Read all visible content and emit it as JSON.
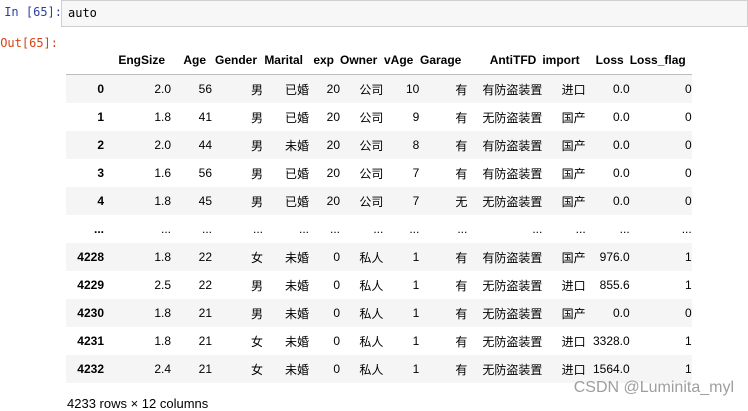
{
  "cell": {
    "in_prompt": "In [65]:",
    "input_code": "auto",
    "out_prompt": "Out[65]:"
  },
  "table": {
    "columns": [
      "",
      "EngSize",
      "Age",
      "Gender",
      "Marital",
      "exp",
      "Owner",
      "vAge",
      "Garage",
      "AntiTFD",
      "import",
      "Loss",
      "Loss_flag"
    ],
    "rows": [
      [
        "0",
        "2.0",
        "56",
        "男",
        "已婚",
        "20",
        "公司",
        "10",
        "有",
        "有防盗装置",
        "进口",
        "0.0",
        "0"
      ],
      [
        "1",
        "1.8",
        "41",
        "男",
        "已婚",
        "20",
        "公司",
        "9",
        "有",
        "无防盗装置",
        "国产",
        "0.0",
        "0"
      ],
      [
        "2",
        "2.0",
        "44",
        "男",
        "未婚",
        "20",
        "公司",
        "8",
        "有",
        "有防盗装置",
        "国产",
        "0.0",
        "0"
      ],
      [
        "3",
        "1.6",
        "56",
        "男",
        "已婚",
        "20",
        "公司",
        "7",
        "有",
        "有防盗装置",
        "国产",
        "0.0",
        "0"
      ],
      [
        "4",
        "1.8",
        "45",
        "男",
        "已婚",
        "20",
        "公司",
        "7",
        "无",
        "无防盗装置",
        "国产",
        "0.0",
        "0"
      ],
      [
        "...",
        "...",
        "...",
        "...",
        "...",
        "...",
        "...",
        "...",
        "...",
        "...",
        "...",
        "...",
        "..."
      ],
      [
        "4228",
        "1.8",
        "22",
        "女",
        "未婚",
        "0",
        "私人",
        "1",
        "有",
        "有防盗装置",
        "国产",
        "976.0",
        "1"
      ],
      [
        "4229",
        "2.5",
        "22",
        "男",
        "未婚",
        "0",
        "私人",
        "1",
        "有",
        "无防盗装置",
        "进口",
        "855.6",
        "1"
      ],
      [
        "4230",
        "1.8",
        "21",
        "男",
        "未婚",
        "0",
        "私人",
        "1",
        "有",
        "无防盗装置",
        "国产",
        "0.0",
        "0"
      ],
      [
        "4231",
        "1.8",
        "21",
        "女",
        "未婚",
        "0",
        "私人",
        "1",
        "有",
        "无防盗装置",
        "进口",
        "3328.0",
        "1"
      ],
      [
        "4232",
        "2.4",
        "21",
        "女",
        "未婚",
        "0",
        "私人",
        "1",
        "有",
        "无防盗装置",
        "进口",
        "1564.0",
        "1"
      ]
    ]
  },
  "footer": "4233 rows × 12 columns",
  "watermark": "CSDN @Luminita_myl"
}
